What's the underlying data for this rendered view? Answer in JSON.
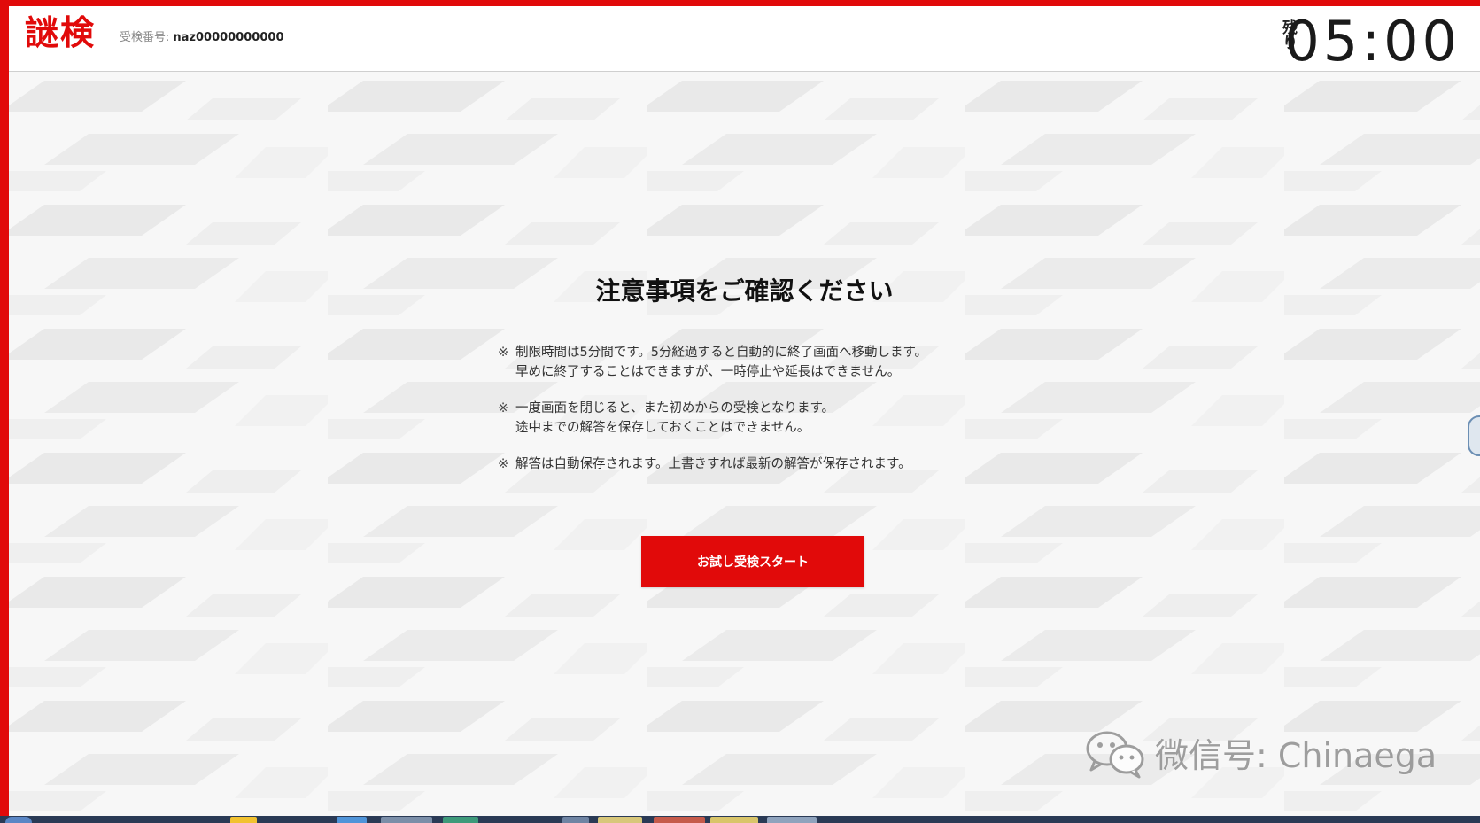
{
  "header": {
    "logo": "謎検",
    "exam_id_label": "受検番号:",
    "exam_id_value": "naz00000000000",
    "timer_label": "残り",
    "timer_value": "05:00"
  },
  "notice": {
    "title": "注意事項をご確認ください",
    "mark": "※",
    "items": [
      {
        "line1": "制限時間は5分間です。5分経過すると自動的に終了画面へ移動します。",
        "line2": "早めに終了することはできますが、一時停止や延長はできません。"
      },
      {
        "line1": "一度画面を閉じると、また初めからの受検となります。",
        "line2": "途中までの解答を保存しておくことはできません。"
      },
      {
        "line1": "解答は自動保存されます。上書きすれば最新の解答が保存されます。",
        "line2": ""
      }
    ],
    "start_button_label": "お試し受検スタート"
  },
  "watermark": {
    "text": "微信号: Chinaega",
    "icon": "wechat-icon"
  },
  "colors": {
    "brand_red": "#e10a0a",
    "text_dark": "#111111",
    "background": "#f6f6f6"
  }
}
